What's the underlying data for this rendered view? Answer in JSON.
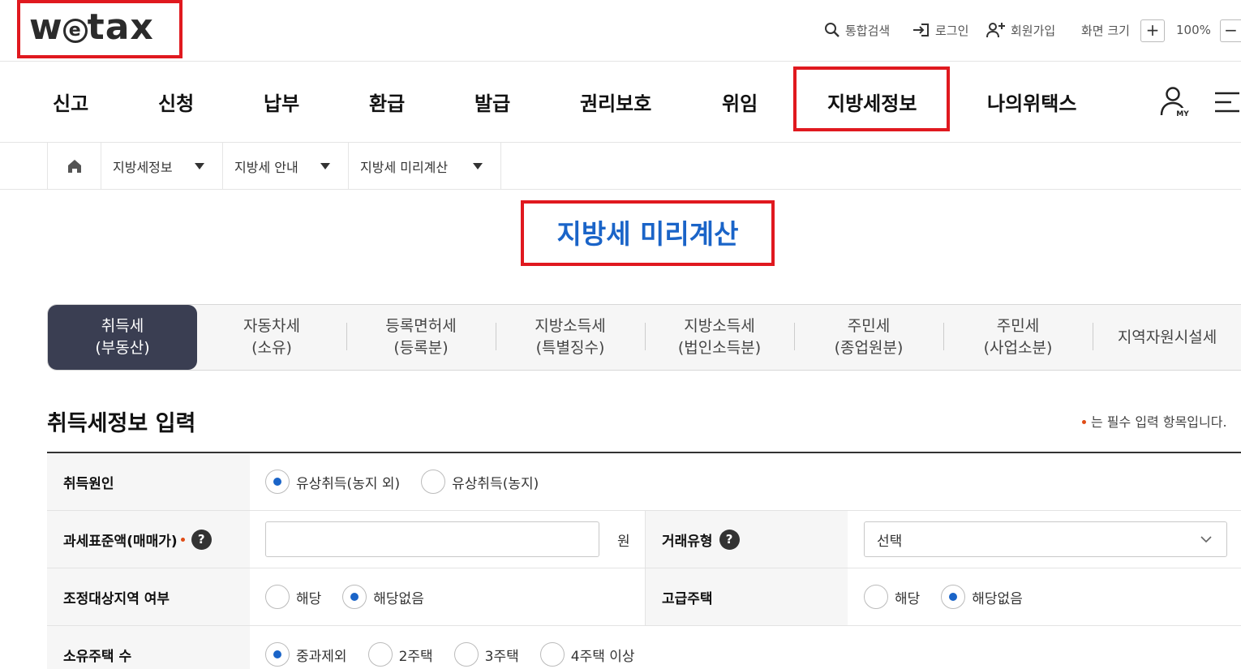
{
  "header": {
    "logo": {
      "pre": "w",
      "e": "e",
      "post": "tax"
    },
    "utility": {
      "search": "통합검색",
      "login": "로그인",
      "signup": "회원가입",
      "screen_size": "화면 크기",
      "zoom_in": "+",
      "zoom_level": "100%",
      "zoom_out": "−"
    }
  },
  "nav": {
    "items": [
      "신고",
      "신청",
      "납부",
      "환급",
      "발급",
      "권리보호",
      "위임",
      "지방세정보",
      "나의위택스"
    ],
    "my_label": "MY"
  },
  "breadcrumb": {
    "items": [
      "지방세정보",
      "지방세 안내",
      "지방세 미리계산"
    ]
  },
  "page": {
    "title": "지방세 미리계산"
  },
  "tabs": [
    {
      "line1": "취득세",
      "line2": "(부동산)"
    },
    {
      "line1": "자동차세",
      "line2": "(소유)"
    },
    {
      "line1": "등록면허세",
      "line2": "(등록분)"
    },
    {
      "line1": "지방소득세",
      "line2": "(특별징수)"
    },
    {
      "line1": "지방소득세",
      "line2": "(법인소득분)"
    },
    {
      "line1": "주민세",
      "line2": "(종업원분)"
    },
    {
      "line1": "주민세",
      "line2": "(사업소분)"
    },
    {
      "line1": "지역자원시설세",
      "line2": ""
    }
  ],
  "form": {
    "section_title": "취득세정보 입력",
    "required_note": "는 필수 입력 항목입니다.",
    "help_glyph": "?",
    "rows": {
      "cause": {
        "label": "취득원인",
        "options": [
          "유상취득(농지 외)",
          "유상취득(농지)"
        ],
        "selected": 0
      },
      "tax_base": {
        "label": "과세표준액(매매가)",
        "value": "",
        "unit": "원"
      },
      "trade_type": {
        "label": "거래유형",
        "selected_value": "선택"
      },
      "regulated": {
        "label": "조정대상지역 여부",
        "options": [
          "해당",
          "해당없음"
        ],
        "selected": 1
      },
      "luxury": {
        "label": "고급주택",
        "options": [
          "해당",
          "해당없음"
        ],
        "selected": 1
      },
      "houses": {
        "label": "소유주택 수",
        "options": [
          "중과제외",
          "2주택",
          "3주택",
          "4주택 이상"
        ],
        "selected": 0
      }
    }
  },
  "colors": {
    "highlight": "#e0191f",
    "accent": "#1a64c8",
    "active_tab": "#3a3e52",
    "required_dot": "#e04c16"
  },
  "icons": [
    "search-icon",
    "login-icon",
    "signup-icon",
    "home-icon",
    "my-page-icon",
    "menu-icon",
    "chevron-down-icon",
    "help-icon"
  ]
}
